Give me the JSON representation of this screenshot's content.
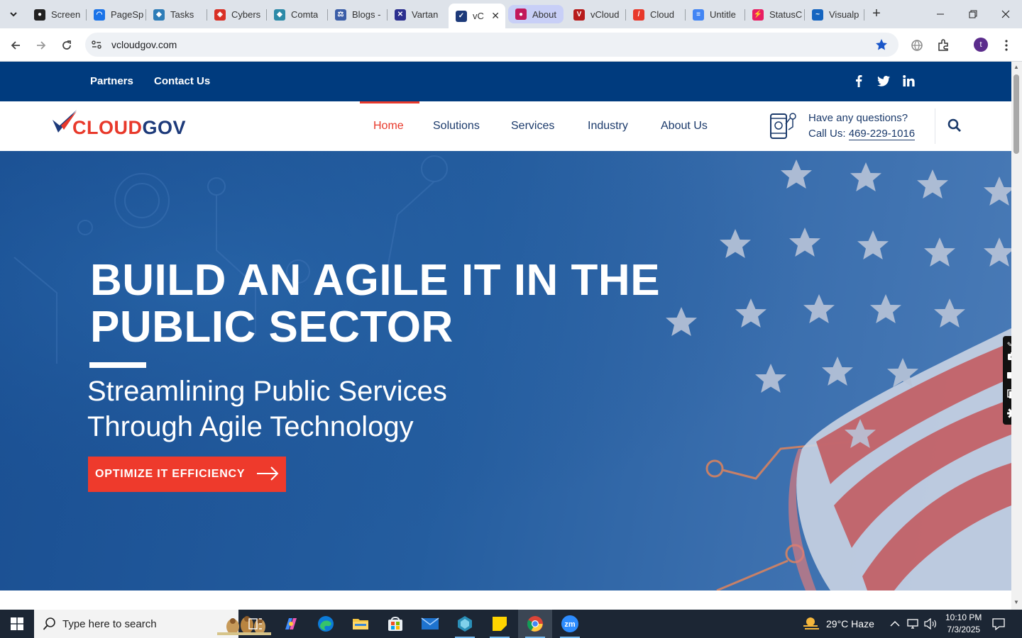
{
  "browser": {
    "tabs": [
      {
        "label": "Screen",
        "fav_color": "#222222"
      },
      {
        "label": "PageSp",
        "fav_color": "#1a73e8"
      },
      {
        "label": "Tasks",
        "fav_color": "#2e7db8"
      },
      {
        "label": "Cybers",
        "fav_color": "#d93025"
      },
      {
        "label": "Comta",
        "fav_color": "#2c8aa8"
      },
      {
        "label": "Blogs -",
        "fav_color": "#3b5ea8"
      },
      {
        "label": "Vartan",
        "fav_color": "#2b2f8f"
      },
      {
        "label": "vC",
        "fav_color": "#1d3a7a"
      },
      {
        "label": "About",
        "fav_color": "#c2185b"
      },
      {
        "label": "vCloud",
        "fav_color": "#b71c1c"
      },
      {
        "label": "Cloud",
        "fav_color": "#e8392b"
      },
      {
        "label": "Untitle",
        "fav_color": "#4285f4"
      },
      {
        "label": "StatusC",
        "fav_color": "#e91e63"
      },
      {
        "label": "Visualp",
        "fav_color": "#1565c0"
      }
    ],
    "new_tab": "+",
    "url": "vcloudgov.com",
    "profile_initial": "t"
  },
  "site": {
    "topbar": {
      "links": [
        "Partners",
        "Contact Us"
      ],
      "social": [
        "f",
        "t",
        "in"
      ]
    },
    "logo": {
      "part1": "CLOUD",
      "part2": "GOV"
    },
    "menu": [
      "Home",
      "Solutions",
      "Services",
      "Industry",
      "About Us"
    ],
    "contact": {
      "question": "Have any questions?",
      "call_prefix": "Call Us: ",
      "phone": "469-229-1016"
    },
    "hero": {
      "title_line1": "BUILD AN AGILE IT IN THE",
      "title_line2": "PUBLIC SECTOR",
      "sub_line1": "Streamlining Public Services",
      "sub_line2": "Through Agile Technology",
      "cta": "OPTIMIZE IT EFFICIENCY"
    }
  },
  "taskbar": {
    "search_placeholder": "Type here to search",
    "weather": "29°C  Haze",
    "time": "10:10 PM",
    "date": "7/3/2025"
  },
  "colors": {
    "brand_red": "#e8392b",
    "brand_navy": "#003b7e",
    "hero_blue": "#245d9f"
  }
}
